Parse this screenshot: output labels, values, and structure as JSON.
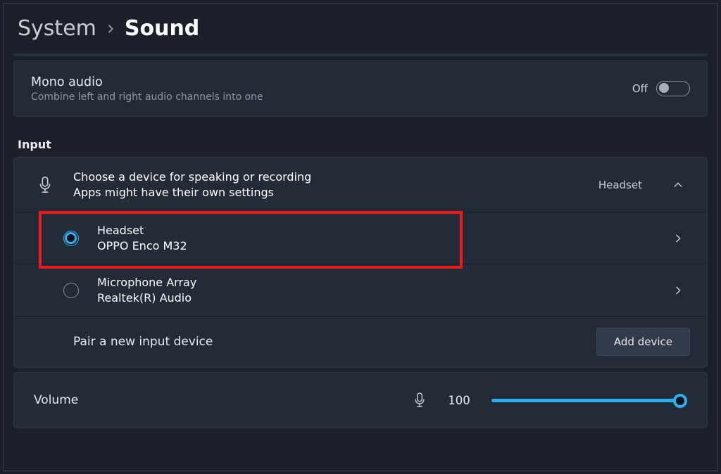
{
  "breadcrumb": {
    "system": "System",
    "sound": "Sound"
  },
  "mono": {
    "title": "Mono audio",
    "subtitle": "Combine left and right audio channels into one",
    "state_label": "Off"
  },
  "input": {
    "section": "Input",
    "chooser_title": "Choose a device for speaking or recording",
    "chooser_subtitle": "Apps might have their own settings",
    "selected_device": "Headset",
    "devices": [
      {
        "title": "Headset",
        "subtitle": "OPPO Enco M32",
        "selected": true
      },
      {
        "title": "Microphone Array",
        "subtitle": "Realtek(R) Audio",
        "selected": false
      }
    ],
    "pair_label": "Pair a new input device",
    "add_device_button": "Add device"
  },
  "volume": {
    "label": "Volume",
    "value": "100"
  },
  "colors": {
    "accent": "#2fb0ed",
    "highlight": "#ef1a1a",
    "panel": "#232b38",
    "bg": "#1b202b"
  }
}
